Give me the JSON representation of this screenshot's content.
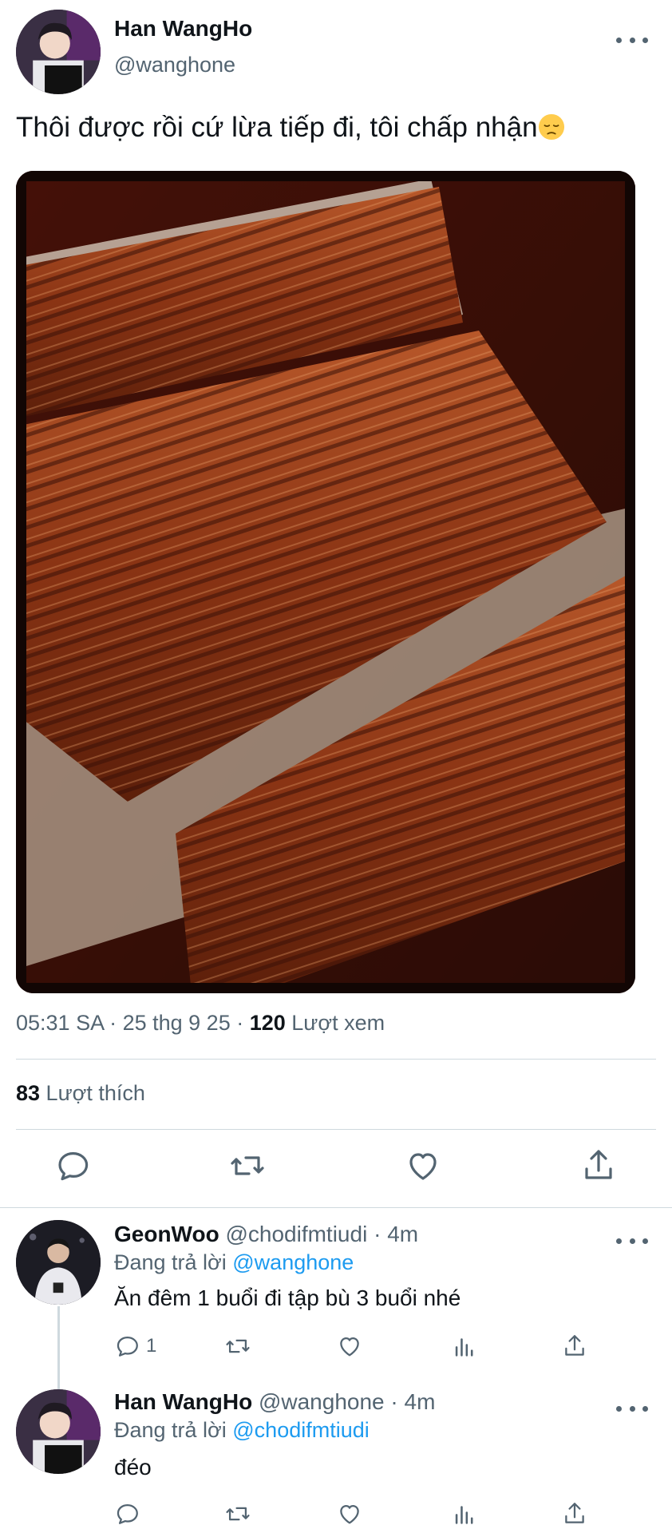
{
  "tweet": {
    "author_name": "Han WangHo",
    "author_handle": "@wanghone",
    "text": "Thôi được rồi cứ lừa tiếp đi, tôi chấp nhận",
    "emoji": "pensive-face-emoji",
    "time": "05:31 SA · 25 thg 9 25 · ",
    "views_count": "120",
    "views_label": " Lượt xem",
    "likes_count": "83",
    "likes_label": " Lượt thích",
    "media": "grilled-eel-photo"
  },
  "actions": [
    "reply-icon",
    "retweet-icon",
    "like-icon",
    "share-icon"
  ],
  "replies": [
    {
      "name": "GeonWoo",
      "handle": "@chodifmtiudi",
      "time": "4m",
      "replying_prefix": "Đang trả lời ",
      "replying_to": "@wanghone",
      "text": "Ăn đêm 1 buổi đi tập bù 3 buổi nhé",
      "reply_count": "1"
    },
    {
      "name": "Han WangHo",
      "handle": "@wanghone",
      "time": "4m",
      "replying_prefix": "Đang trả lời ",
      "replying_to": "@chodifmtiudi",
      "text": "đéo",
      "reply_count": ""
    }
  ],
  "colors": {
    "text": "#0f1419",
    "secondary": "#536471",
    "link": "#1d9bf0",
    "divider": "#cfd9de"
  }
}
